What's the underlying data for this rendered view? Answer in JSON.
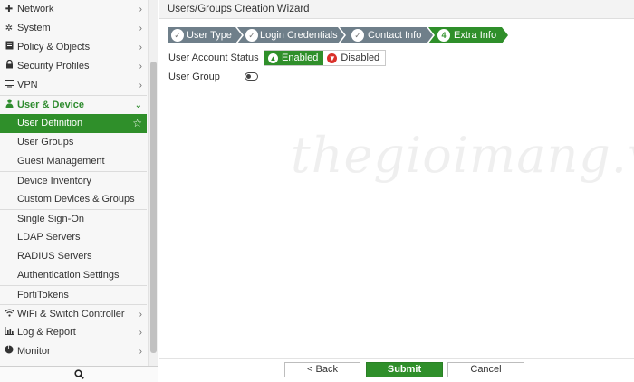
{
  "sidebar": {
    "items": [
      {
        "label": "Network",
        "icon": "plus-cross-icon",
        "chevron": "›"
      },
      {
        "label": "System",
        "icon": "gear-icon",
        "chevron": "›"
      },
      {
        "label": "Policy & Objects",
        "icon": "document-icon",
        "chevron": "›"
      },
      {
        "label": "Security Profiles",
        "icon": "lock-icon",
        "chevron": "›"
      },
      {
        "label": "VPN",
        "icon": "monitor-icon",
        "chevron": "›"
      },
      {
        "label": "User & Device",
        "icon": "user-icon",
        "chevron": "⌄"
      },
      {
        "label": "User Definition",
        "icon": "",
        "chevron": "☆"
      },
      {
        "label": "User Groups"
      },
      {
        "label": "Guest Management"
      },
      {
        "label": "Device Inventory"
      },
      {
        "label": "Custom Devices & Groups"
      },
      {
        "label": "Single Sign-On"
      },
      {
        "label": "LDAP Servers"
      },
      {
        "label": "RADIUS Servers"
      },
      {
        "label": "Authentication Settings"
      },
      {
        "label": "FortiTokens"
      },
      {
        "label": "WiFi & Switch Controller",
        "icon": "wifi-icon",
        "chevron": "›"
      },
      {
        "label": "Log & Report",
        "icon": "bar-chart-icon",
        "chevron": "›"
      },
      {
        "label": "Monitor",
        "icon": "pie-chart-icon",
        "chevron": "›"
      }
    ],
    "search_icon": "search-icon"
  },
  "wizard": {
    "title": "Users/Groups Creation Wizard",
    "steps": [
      {
        "label": "User Type",
        "mark": "✓",
        "state": "done"
      },
      {
        "label": "Login Credentials",
        "mark": "✓",
        "state": "done"
      },
      {
        "label": "Contact Info",
        "mark": "✓",
        "state": "done"
      },
      {
        "label": "Extra Info",
        "mark": "4",
        "state": "current"
      }
    ],
    "fields": {
      "account_status_label": "User Account Status",
      "enabled_label": "Enabled",
      "disabled_label": "Disabled",
      "selected_status": "Enabled",
      "user_group_label": "User Group",
      "user_group_on": false
    }
  },
  "footer": {
    "back_label": "< Back",
    "submit_label": "Submit",
    "cancel_label": "Cancel"
  },
  "watermark": "thegioimang.vn",
  "colors": {
    "accent_green": "#2f8f2a",
    "step_done_gray": "#6f7f8a",
    "disabled_red": "#d9302a"
  }
}
